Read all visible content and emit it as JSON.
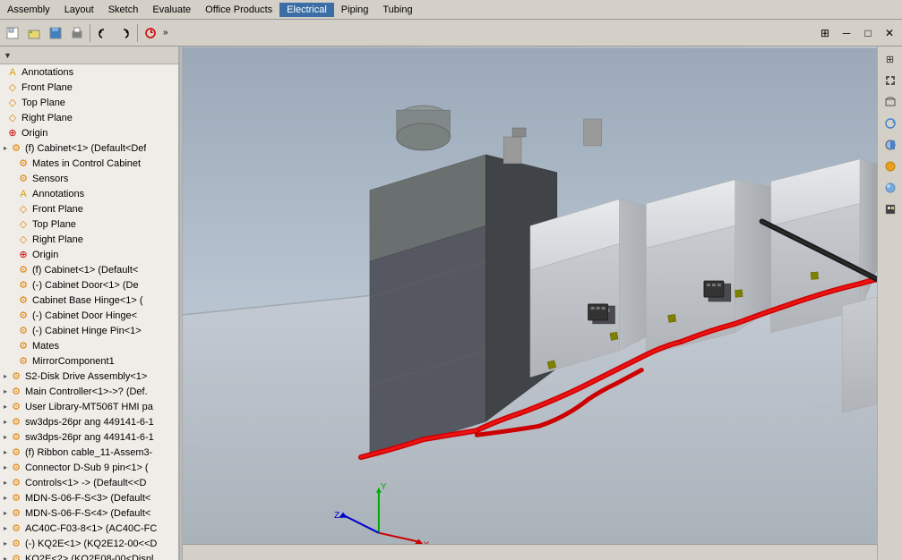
{
  "menubar": {
    "items": [
      {
        "label": "Assembly",
        "id": "assembly",
        "active": false
      },
      {
        "label": "Layout",
        "id": "layout",
        "active": false
      },
      {
        "label": "Sketch",
        "id": "sketch",
        "active": false
      },
      {
        "label": "Evaluate",
        "id": "evaluate",
        "active": false
      },
      {
        "label": "Office Products",
        "id": "office",
        "active": false
      },
      {
        "label": "Electrical",
        "id": "electrical",
        "active": true
      },
      {
        "label": "Piping",
        "id": "piping",
        "active": false
      },
      {
        "label": "Tubing",
        "id": "tubing",
        "active": false
      }
    ]
  },
  "toolbar": {
    "expand_label": "»"
  },
  "feature_tree": {
    "header_label": "▼",
    "items": [
      {
        "id": "annotations1",
        "label": "Annotations",
        "indent": 0,
        "icon": "A",
        "icon_color": "#d4a000"
      },
      {
        "id": "front-plane1",
        "label": "Front Plane",
        "indent": 0,
        "icon": "◇",
        "icon_color": "#e08000"
      },
      {
        "id": "top-plane1",
        "label": "Top Plane",
        "indent": 0,
        "icon": "◇",
        "icon_color": "#e08000"
      },
      {
        "id": "right-plane1",
        "label": "Right Plane",
        "indent": 0,
        "icon": "◇",
        "icon_color": "#e08000"
      },
      {
        "id": "origin1",
        "label": "Origin",
        "indent": 0,
        "icon": "⊕",
        "icon_color": "#cc0000"
      },
      {
        "id": "cabinet1",
        "label": "(f) Cabinet<1> (Default<Def",
        "indent": 0,
        "icon": "⚙",
        "icon_color": "#e08000"
      },
      {
        "id": "mates-control",
        "label": "Mates in Control Cabinet",
        "indent": 1,
        "icon": "⚙",
        "icon_color": "#e08000"
      },
      {
        "id": "sensors",
        "label": "Sensors",
        "indent": 1,
        "icon": "⚙",
        "icon_color": "#e08000"
      },
      {
        "id": "annotations2",
        "label": "Annotations",
        "indent": 1,
        "icon": "A",
        "icon_color": "#d4a000"
      },
      {
        "id": "front-plane2",
        "label": "Front Plane",
        "indent": 1,
        "icon": "◇",
        "icon_color": "#e08000"
      },
      {
        "id": "top-plane2",
        "label": "Top Plane",
        "indent": 1,
        "icon": "◇",
        "icon_color": "#e08000"
      },
      {
        "id": "right-plane2",
        "label": "Right Plane",
        "indent": 1,
        "icon": "◇",
        "icon_color": "#e08000"
      },
      {
        "id": "origin2",
        "label": "Origin",
        "indent": 1,
        "icon": "⊕",
        "icon_color": "#cc0000"
      },
      {
        "id": "cabinet1b",
        "label": "(f) Cabinet<1> (Default<",
        "indent": 1,
        "icon": "⚙",
        "icon_color": "#e08000"
      },
      {
        "id": "cabinet-door",
        "label": "(-) Cabinet Door<1> (De",
        "indent": 1,
        "icon": "⚙",
        "icon_color": "#e08000"
      },
      {
        "id": "cabinet-base",
        "label": "Cabinet Base Hinge<1> (",
        "indent": 1,
        "icon": "⚙",
        "icon_color": "#e08000"
      },
      {
        "id": "cabinet-door-hinge",
        "label": "(-) Cabinet Door Hinge<",
        "indent": 1,
        "icon": "⚙",
        "icon_color": "#e08000"
      },
      {
        "id": "cabinet-hinge-pin",
        "label": "(-) Cabinet Hinge Pin<1>",
        "indent": 1,
        "icon": "⚙",
        "icon_color": "#e08000"
      },
      {
        "id": "mates",
        "label": "Mates",
        "indent": 1,
        "icon": "⚙",
        "icon_color": "#e08000"
      },
      {
        "id": "mirror1",
        "label": "MirrorComponent1",
        "indent": 1,
        "icon": "⚙",
        "icon_color": "#e08000"
      },
      {
        "id": "s2-disk",
        "label": "S2-Disk Drive Assembly<1>",
        "indent": 0,
        "icon": "⚙",
        "icon_color": "#e08000"
      },
      {
        "id": "main-ctrl",
        "label": "Main Controller<1>->? (Def.",
        "indent": 0,
        "icon": "⚙",
        "icon_color": "#e08000"
      },
      {
        "id": "user-library",
        "label": "User Library-MT506T HMI pa",
        "indent": 0,
        "icon": "⚙",
        "icon_color": "#e08000"
      },
      {
        "id": "sw3dps-1",
        "label": "sw3dps-26pr ang 449141-6-1",
        "indent": 0,
        "icon": "⚙",
        "icon_color": "#e08000"
      },
      {
        "id": "sw3dps-2",
        "label": "sw3dps-26pr ang 449141-6-1",
        "indent": 0,
        "icon": "⚙",
        "icon_color": "#e08000"
      },
      {
        "id": "ribbon-cable",
        "label": "(f) Ribbon cable_11-Assem3-",
        "indent": 0,
        "icon": "⚙",
        "icon_color": "#e08000"
      },
      {
        "id": "connector-d",
        "label": "Connector D-Sub 9 pin<1> (",
        "indent": 0,
        "icon": "⚙",
        "icon_color": "#e08000"
      },
      {
        "id": "controls1",
        "label": "Controls<1> -> (Default<<D",
        "indent": 0,
        "icon": "⚙",
        "icon_color": "#e08000"
      },
      {
        "id": "mdn-s06-f-s3",
        "label": "MDN-S-06-F-S<3> (Default<",
        "indent": 0,
        "icon": "⚙",
        "icon_color": "#e08000"
      },
      {
        "id": "mdn-s06-f-s4",
        "label": "MDN-S-06-F-S<4> (Default<",
        "indent": 0,
        "icon": "⚙",
        "icon_color": "#e08000"
      },
      {
        "id": "ac40c-f03",
        "label": "AC40C-F03-8<1> (AC40C-FC",
        "indent": 0,
        "icon": "⚙",
        "icon_color": "#e08000"
      },
      {
        "id": "kq2e1",
        "label": "(-) KQ2E<1> (KQ2E12-00<<D",
        "indent": 0,
        "icon": "⚙",
        "icon_color": "#e08000"
      },
      {
        "id": "kq2e2",
        "label": "KQ2E<2> (KQ2E08-00<Displ.",
        "indent": 0,
        "icon": "⚙",
        "icon_color": "#e08000"
      }
    ]
  },
  "right_toolbar": {
    "buttons": [
      {
        "id": "btn1",
        "icon": "⊞",
        "label": "view-options"
      },
      {
        "id": "btn2",
        "icon": "↗",
        "label": "zoom-in"
      },
      {
        "id": "btn3",
        "icon": "↙",
        "label": "zoom-out"
      },
      {
        "id": "btn4",
        "icon": "⌂",
        "label": "home-view"
      },
      {
        "id": "btn5",
        "icon": "◫",
        "label": "front-view"
      },
      {
        "id": "btn6",
        "icon": "🔵",
        "label": "render-mode"
      },
      {
        "id": "btn7",
        "icon": "◉",
        "label": "rotate"
      },
      {
        "id": "btn8",
        "icon": "⊡",
        "label": "section-view"
      }
    ]
  },
  "statusbar": {
    "text": ""
  },
  "scene": {
    "floor_color": "#c0c8d0",
    "bg_color": "#b8c0cc"
  }
}
